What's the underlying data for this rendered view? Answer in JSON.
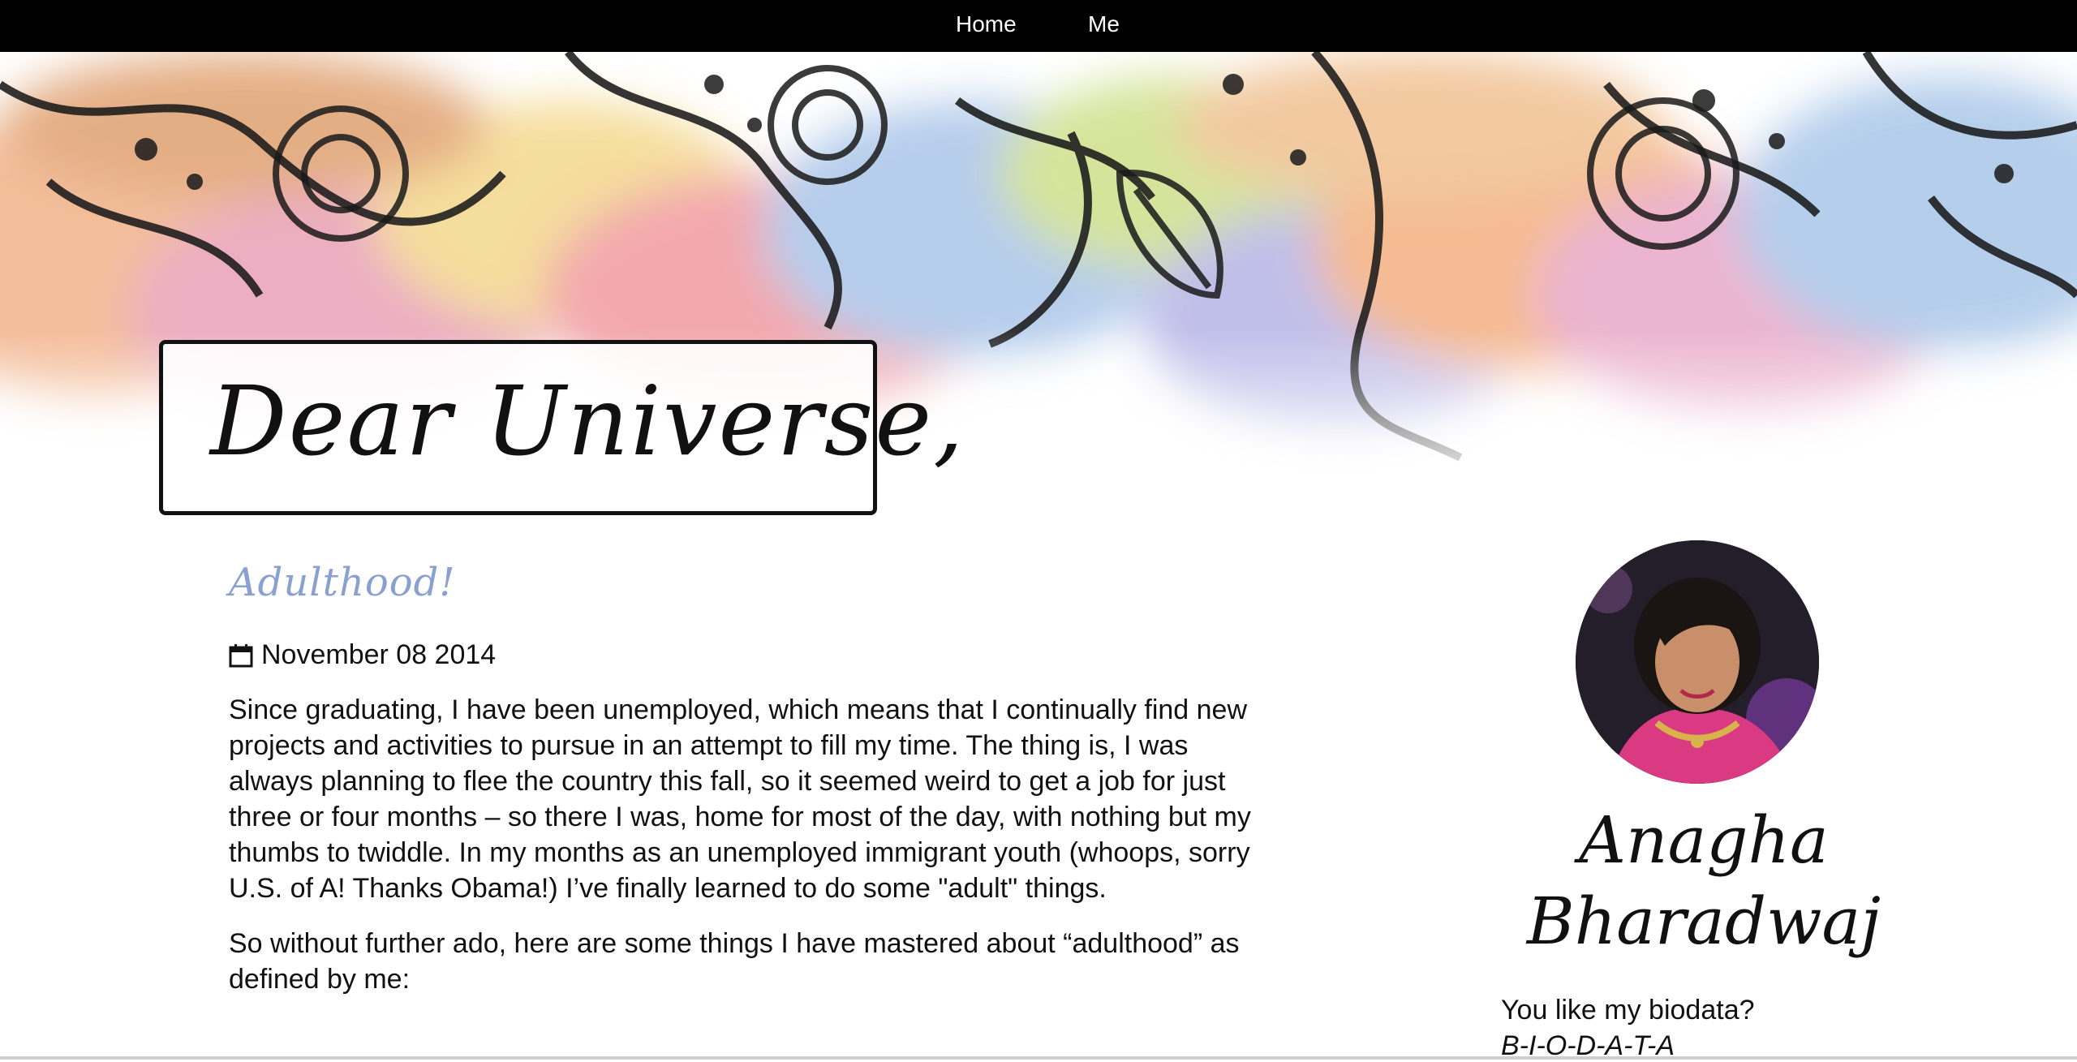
{
  "nav": {
    "items": [
      {
        "label": "Home"
      },
      {
        "label": "Me"
      }
    ]
  },
  "blog": {
    "title": "Dear Universe,"
  },
  "post": {
    "title": "Adulthood!",
    "date": "November 08 2014",
    "paragraphs": [
      "Since graduating, I have been unemployed, which means that I continually find new projects and activities to pursue in an attempt to fill my time. The thing is, I was always planning to flee the country this fall, so it seemed weird to get a job for just three or four months – so there I was, home for most of the day, with nothing but my thumbs to twiddle. In my months as an unemployed immigrant youth (whoops, sorry U.S. of A! Thanks Obama!) I’ve finally learned to do some \"adult\" things.",
      "So without further ado, here are some things I have mastered about “adulthood” as defined by me:"
    ]
  },
  "sidebar": {
    "author_name_line1": "Anagha",
    "author_name_line2": "Bharadwaj",
    "biodata_question": "You like my biodata?",
    "biodata_answer": "B-I-O-D-A-T-A"
  },
  "icons": {
    "date": "calendar-icon"
  },
  "colors": {
    "nav_bg": "#000000",
    "post_title": "#8aa0d0",
    "text": "#111111"
  }
}
